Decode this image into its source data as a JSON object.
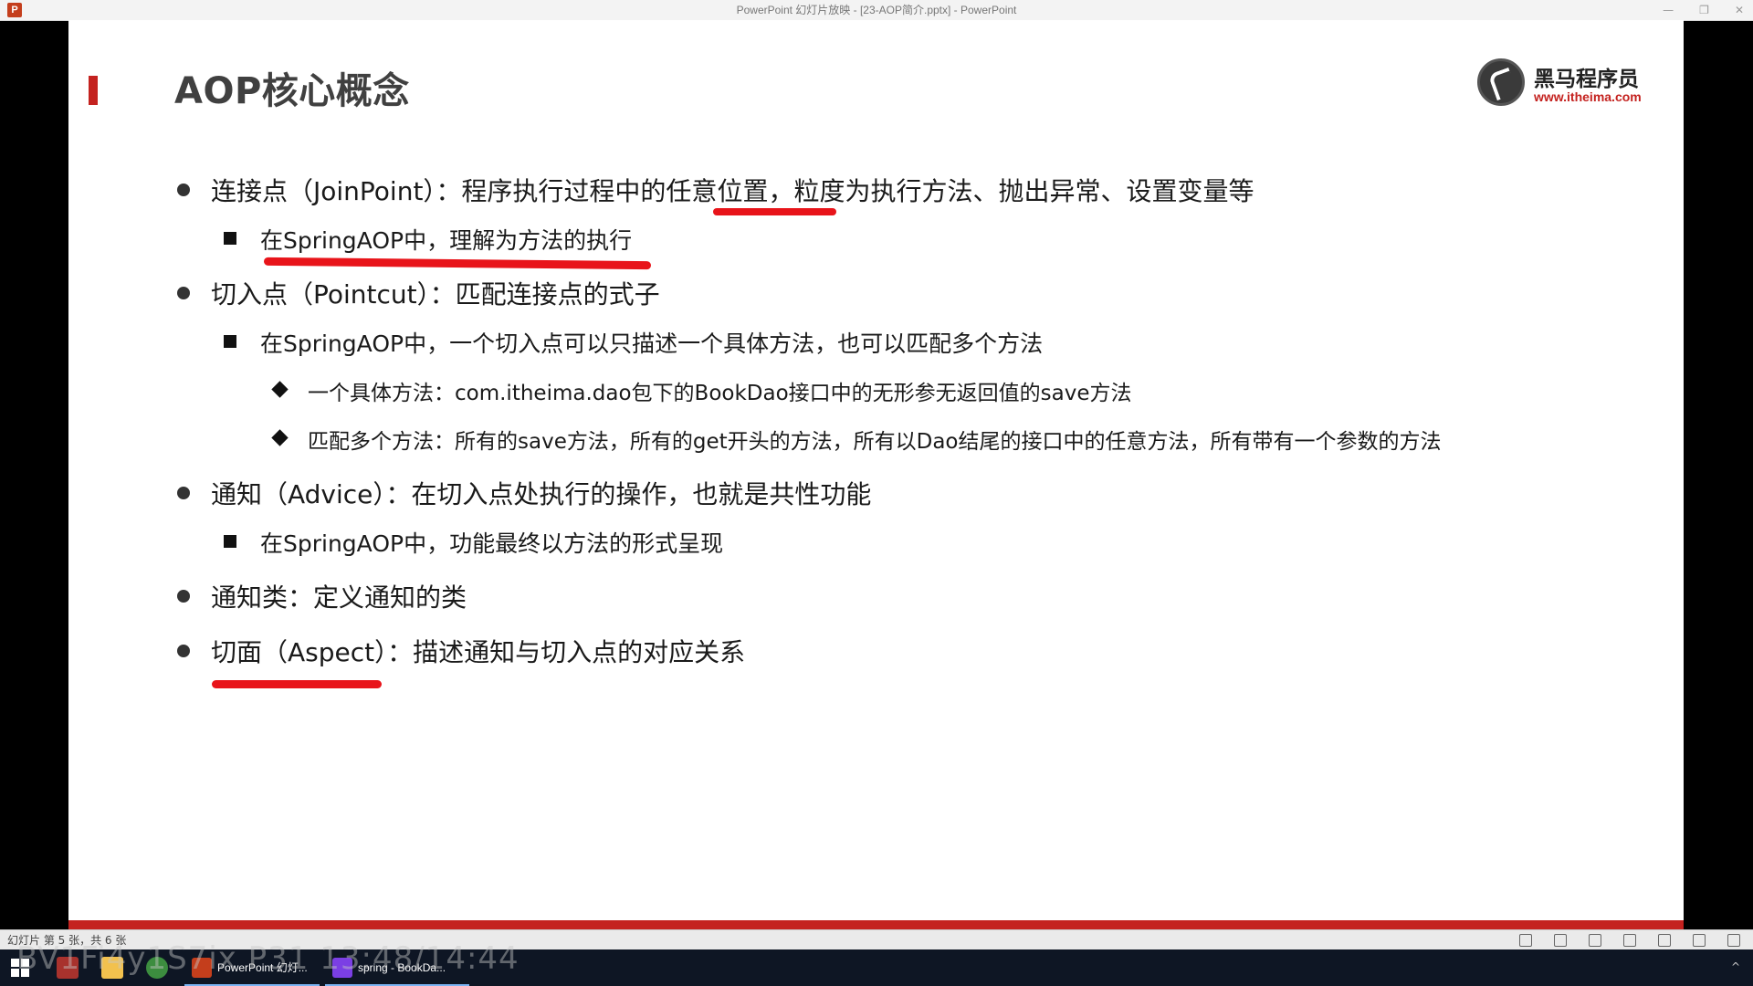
{
  "window": {
    "title": "PowerPoint 幻灯片放映 - [23-AOP简介.pptx] - PowerPoint",
    "app_icon": "P",
    "buttons": [
      "—",
      "❐",
      "✕"
    ]
  },
  "slide": {
    "title": "AOP核心概念",
    "logo": {
      "name": "黑马程序员",
      "url": "www.itheima.com"
    },
    "items": [
      {
        "level": 1,
        "text": "连接点（JoinPoint）：程序执行过程中的任意位置，粒度为执行方法、抛出异常、设置变量等"
      },
      {
        "level": 2,
        "text": "在SpringAOP中，理解为方法的执行"
      },
      {
        "level": 1,
        "text": "切入点（Pointcut）：匹配连接点的式子"
      },
      {
        "level": 2,
        "text": "在SpringAOP中，一个切入点可以只描述一个具体方法，也可以匹配多个方法"
      },
      {
        "level": 3,
        "text": "一个具体方法：com.itheima.dao包下的BookDao接口中的无形参无返回值的save方法"
      },
      {
        "level": 3,
        "text": "匹配多个方法：所有的save方法，所有的get开头的方法，所有以Dao结尾的接口中的任意方法，所有带有一个参数的方法"
      },
      {
        "level": 1,
        "text": "通知（Advice）：在切入点处执行的操作，也就是共性功能"
      },
      {
        "level": 2,
        "text": "在SpringAOP中，功能最终以方法的形式呈现"
      },
      {
        "level": 1,
        "text": "通知类：定义通知的类"
      },
      {
        "level": 1,
        "text": "切面（Aspect）：描述通知与切入点的对应关系"
      }
    ],
    "accent_color": "#c4221f",
    "annotation_color": "#e8141a"
  },
  "statusbar": {
    "slide_info": "幻灯片 第 5 张，共 6 张"
  },
  "taskbar": {
    "tasks": [
      {
        "label": "PowerPoint 幻灯...",
        "color": "#c43e1c"
      },
      {
        "label": "spring - BookDa...",
        "color": "#7b3fe4"
      }
    ],
    "overlay": "BV1Fi4y1S7ix P31 13:48/14:44"
  }
}
